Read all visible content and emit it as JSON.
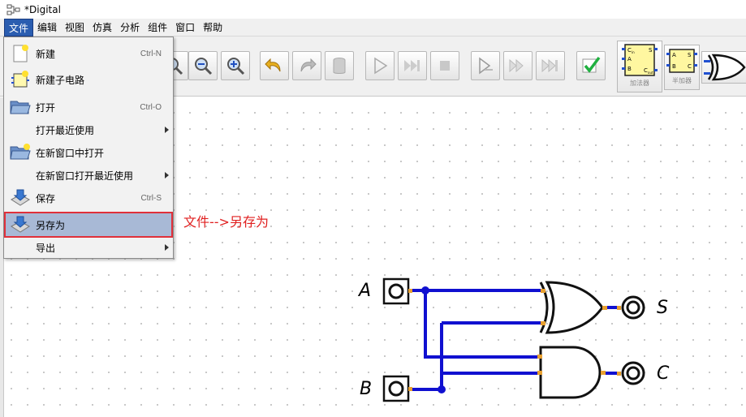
{
  "window": {
    "title": "*Digital"
  },
  "menubar": {
    "items": [
      {
        "label": "文件",
        "active": true
      },
      {
        "label": "编辑"
      },
      {
        "label": "视图"
      },
      {
        "label": "仿真"
      },
      {
        "label": "分析"
      },
      {
        "label": "组件"
      },
      {
        "label": "窗口"
      },
      {
        "label": "帮助"
      }
    ]
  },
  "file_menu": {
    "new": {
      "label": "新建",
      "shortcut": "Ctrl-N",
      "icon": "new-file-icon"
    },
    "new_sub": {
      "label": "新建子电路",
      "icon": "new-subcircuit-icon"
    },
    "open": {
      "label": "打开",
      "shortcut": "Ctrl-O",
      "icon": "folder-icon"
    },
    "open_recent": {
      "label": "打开最近使用"
    },
    "open_new_window": {
      "label": "在新窗口中打开",
      "icon": "folder-new-icon"
    },
    "open_recent_new_window": {
      "label": "在新窗口打开最近使用"
    },
    "save": {
      "label": "保存",
      "shortcut": "Ctrl-S",
      "icon": "save-icon"
    },
    "save_as": {
      "label": "另存为",
      "icon": "save-as-icon"
    },
    "export": {
      "label": "导出"
    }
  },
  "annotation": {
    "text": "文件-->另存为",
    "color": "#e02020"
  },
  "toolbar": {
    "components": [
      {
        "label": "加法器",
        "pins": [
          "C_in",
          "A",
          "B",
          "S",
          "C_out"
        ]
      },
      {
        "label": "半加器",
        "pins": [
          "A",
          "B",
          "S",
          "C"
        ]
      }
    ]
  },
  "circuit": {
    "inputs": [
      "A",
      "B"
    ],
    "outputs": [
      "S",
      "C"
    ],
    "wire_color": "#1010d0",
    "pin_color": "#e8a030"
  }
}
